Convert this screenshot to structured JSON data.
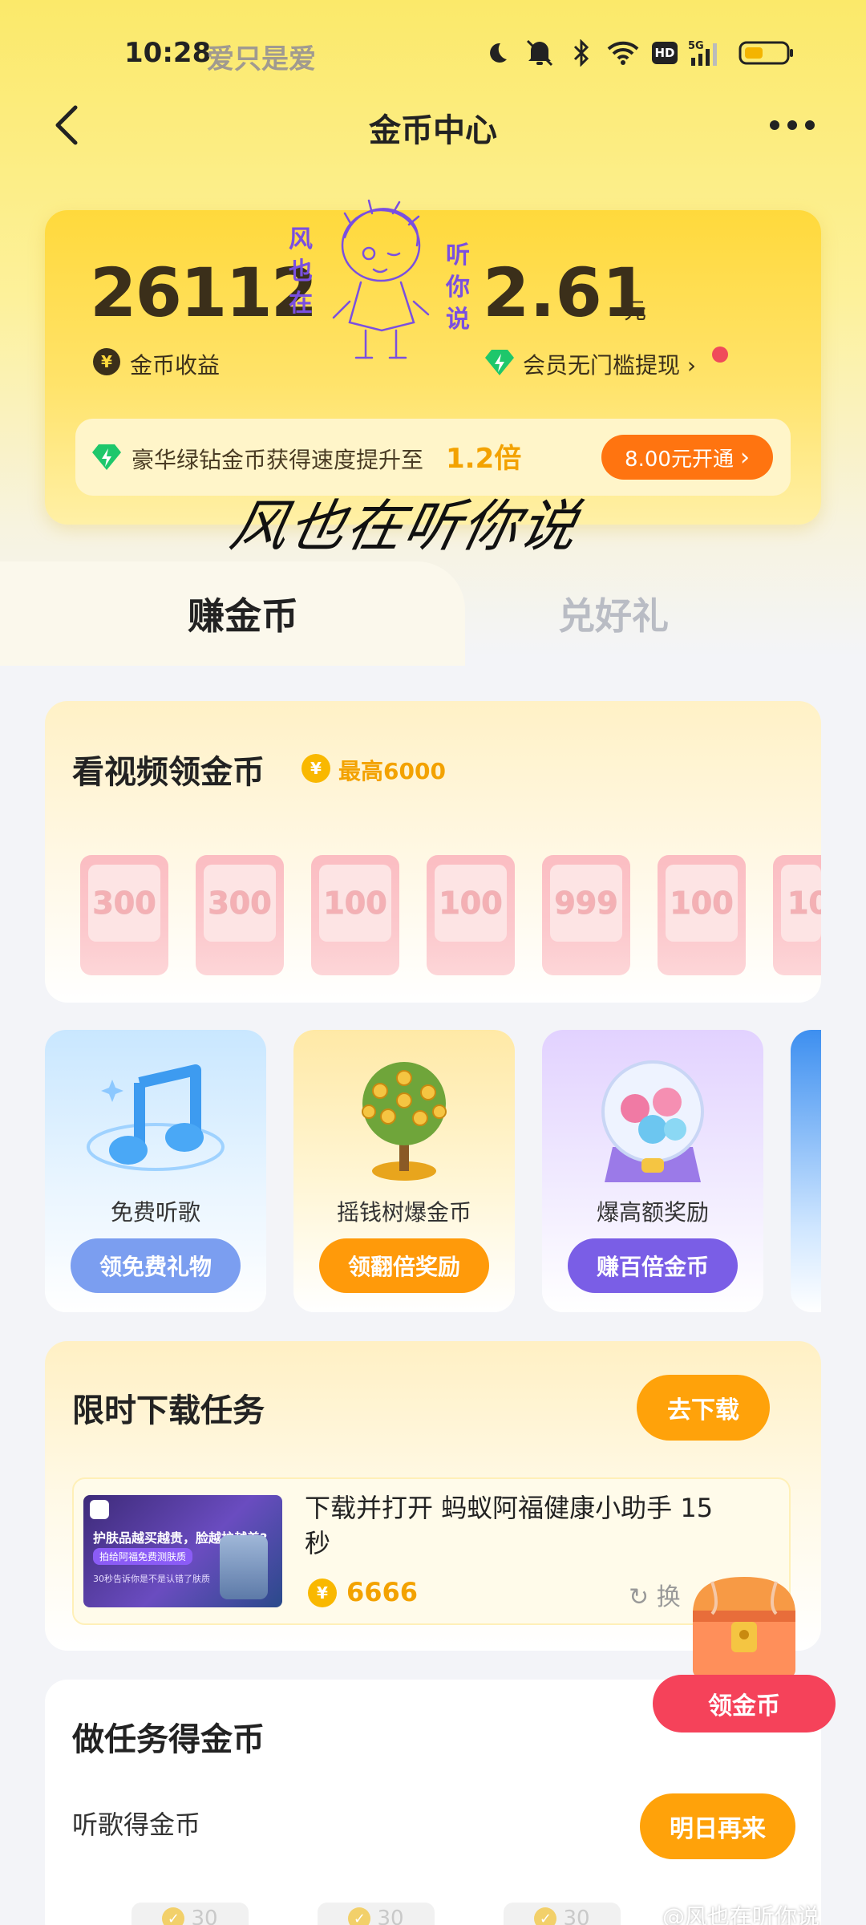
{
  "status_bar": {
    "time": "10:28",
    "carrier_text": "爱只是爱",
    "icons": [
      "moon-icon",
      "mute-icon",
      "bluetooth-icon",
      "wifi-icon",
      "hd-icon",
      "signal-5g-icon",
      "battery-icon"
    ],
    "hd_label": "HD",
    "network_label": "5G"
  },
  "nav": {
    "title": "金币中心"
  },
  "balance": {
    "coins": "26112",
    "coins_label": "金币收益",
    "money": "2.61",
    "money_unit": "元",
    "vip_label": "会员无门槛提现",
    "promo_text": "豪华绿钻金币获得速度提升至",
    "promo_multiplier": "1.2倍",
    "promo_button": "8.00元开通"
  },
  "watermark": {
    "doodle_text": [
      "风",
      "也",
      "在",
      "听",
      "你",
      "说"
    ],
    "signature": "风也在听你说",
    "footer": "@风也在听你说"
  },
  "tabs": [
    {
      "label": "赚金币",
      "active": true
    },
    {
      "label": "兑好礼",
      "active": false
    }
  ],
  "video": {
    "title": "看视频领金币",
    "max_text": "最高6000",
    "rewards": [
      "300",
      "300",
      "100",
      "100",
      "999",
      "100",
      "10"
    ]
  },
  "features": [
    {
      "label": "免费听歌",
      "button": "领免费礼物",
      "color": "#7b9ef0"
    },
    {
      "label": "摇钱树爆金币",
      "button": "领翻倍奖励",
      "color": "#ff9a0a"
    },
    {
      "label": "爆高额奖励",
      "button": "赚百倍金币",
      "color": "#7a5ee6"
    }
  ],
  "download": {
    "title": "限时下载任务",
    "button": "去下载",
    "task_name": "下载并打开 蚂蚁阿福健康小助手 15秒",
    "coins": "6666",
    "swap_label": "换",
    "thumb_headline": "护肤品越买越贵，脸越护越差?",
    "thumb_tag": "拍给阿福免费测肤质",
    "thumb_note": "30秒告诉你是不是认错了肤质"
  },
  "tasks": {
    "title": "做任务得金币",
    "item_label": "听歌得金币",
    "item_button": "明日再来",
    "checks": [
      "30",
      "30",
      "30"
    ]
  },
  "floating": {
    "button": "领金币"
  }
}
